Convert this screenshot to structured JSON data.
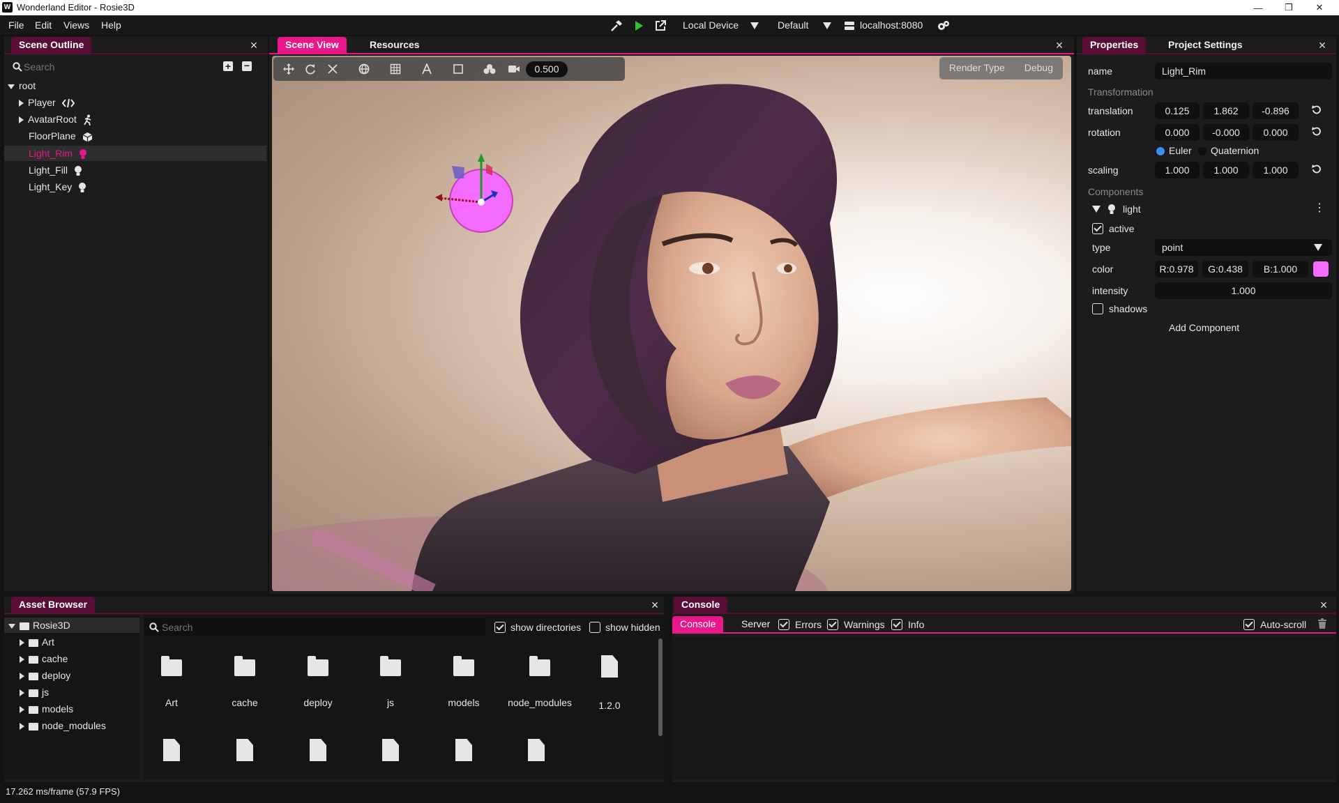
{
  "window": {
    "title": "Wonderland Editor - Rosie3D"
  },
  "menu": {
    "items": [
      "File",
      "Edit",
      "Views",
      "Help"
    ]
  },
  "toolbar": {
    "device": "Local Device",
    "profile": "Default",
    "server": "localhost:8080"
  },
  "scene_outline": {
    "title": "Scene Outline",
    "search_placeholder": "Search",
    "items": [
      {
        "label": "root"
      },
      {
        "label": "Player"
      },
      {
        "label": "AvatarRoot"
      },
      {
        "label": "FloorPlane"
      },
      {
        "label": "Light_Rim"
      },
      {
        "label": "Light_Fill"
      },
      {
        "label": "Light_Key"
      }
    ]
  },
  "scene_view": {
    "tabs": [
      "Scene View",
      "Resources"
    ],
    "zoom_value": "0.500",
    "render_type_label": "Render Type",
    "debug_label": "Debug"
  },
  "properties": {
    "tabs": [
      "Properties",
      "Project Settings"
    ],
    "name_label": "name",
    "name_value": "Light_Rim",
    "transformation_label": "Transformation",
    "translation_label": "translation",
    "translation": [
      "0.125",
      "1.862",
      "-0.896"
    ],
    "rotation_label": "rotation",
    "rotation": [
      "0.000",
      "-0.000",
      "0.000"
    ],
    "euler_label": "Euler",
    "quaternion_label": "Quaternion",
    "scaling_label": "scaling",
    "scaling": [
      "1.000",
      "1.000",
      "1.000"
    ],
    "components_label": "Components",
    "component_name": "light",
    "active_label": "active",
    "type_label": "type",
    "type_value": "point",
    "color_label": "color",
    "color_r": "R:0.978",
    "color_g": "G:0.438",
    "color_b": "B:1.000",
    "color_swatch": "#f36cff",
    "intensity_label": "intensity",
    "intensity_value": "1.000",
    "shadows_label": "shadows",
    "add_component_label": "Add Component"
  },
  "asset_browser": {
    "title": "Asset Browser",
    "tree": [
      {
        "label": "Rosie3D"
      },
      {
        "label": "Art"
      },
      {
        "label": "cache"
      },
      {
        "label": "deploy"
      },
      {
        "label": "js"
      },
      {
        "label": "models"
      },
      {
        "label": "node_modules"
      }
    ],
    "search_placeholder": "Search",
    "show_directories_label": "show directories",
    "show_hidden_label": "show hidden",
    "items": [
      "Art",
      "cache",
      "deploy",
      "js",
      "models",
      "node_modules",
      "1.2.0"
    ]
  },
  "console": {
    "title": "Console",
    "tabs": [
      "Console",
      "Server"
    ],
    "errors_label": "Errors",
    "warnings_label": "Warnings",
    "info_label": "Info",
    "autoscroll_label": "Auto-scroll"
  },
  "status": {
    "text": "17.262 ms/frame (57.9 FPS)"
  },
  "colors": {
    "accent": "#e8178a",
    "accent_dark": "#5a0d36",
    "selected_text": "#e8178a"
  }
}
